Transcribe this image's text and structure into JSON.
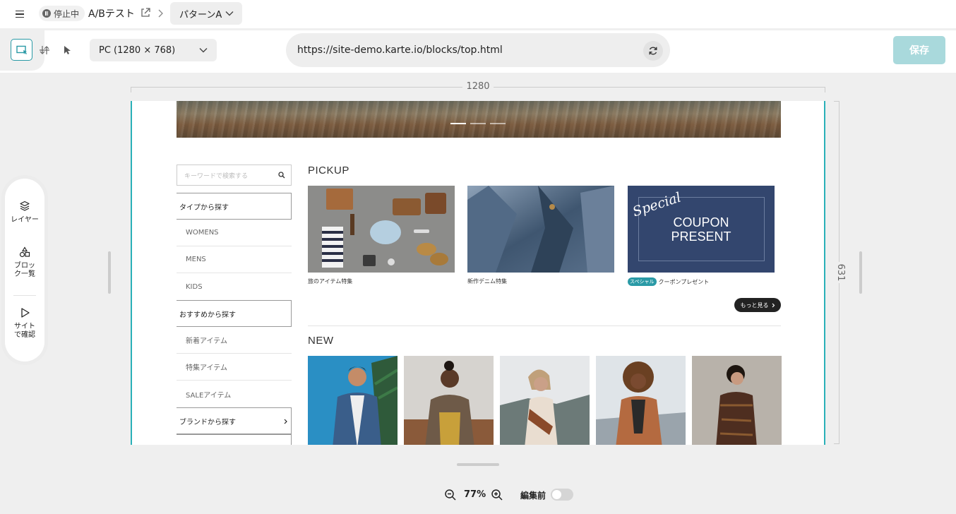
{
  "header": {
    "status": "停止中",
    "campaign_title": "A/Bテスト",
    "pattern": "パターンA"
  },
  "toolbar": {
    "device": "PC (1280 × 768)",
    "url": "https://site-demo.karte.io/blocks/top.html",
    "save_label": "保存"
  },
  "ruler": {
    "width_label": "1280",
    "height_label": "631"
  },
  "side_panel": {
    "items": [
      {
        "label": "レイヤー",
        "icon": "layers-icon"
      },
      {
        "label": "ブロック一覧",
        "icon": "shapes-icon"
      },
      {
        "label": "サイトで確認",
        "icon": "play-icon"
      }
    ]
  },
  "site": {
    "search_placeholder": "キーワードで検索する",
    "categories": [
      {
        "type": "head",
        "label": "タイプから探す"
      },
      {
        "type": "item",
        "label": "WOMENS"
      },
      {
        "type": "item",
        "label": "MENS"
      },
      {
        "type": "item",
        "label": "KIDS"
      },
      {
        "type": "head",
        "label": "おすすめから探す"
      },
      {
        "type": "item",
        "label": "新着アイテム"
      },
      {
        "type": "item",
        "label": "特集アイテム"
      },
      {
        "type": "item",
        "label": "SALEアイテム"
      },
      {
        "type": "head",
        "label": "ブランドから探す"
      }
    ],
    "pickup_title": "PICKUP",
    "pickup": [
      {
        "caption": "旅のアイテム特集"
      },
      {
        "caption": "新作デニム特集"
      },
      {
        "caption": "クーポンプレゼント",
        "badge": "スペシャル",
        "img_script": "Special",
        "img_line1": "COUPON",
        "img_line2": "PRESENT"
      }
    ],
    "more_label": "もっと見る",
    "new_title": "NEW"
  },
  "footer": {
    "zoom": "77%",
    "edit_toggle_label": "編集前"
  }
}
